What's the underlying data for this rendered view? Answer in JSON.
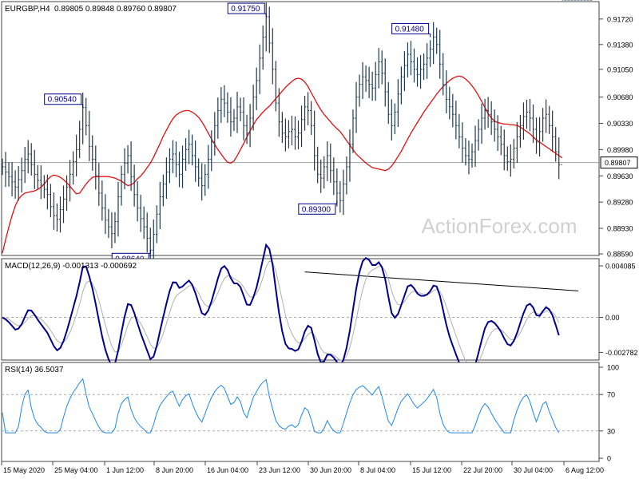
{
  "chart_data": {
    "type": "line",
    "instrument_label": "EURGBP,H4",
    "ohlc_label": "0.89805 0.89848 0.89760 0.89807",
    "x_ticks": [
      "15 May 2020",
      "25 May 04:00",
      "1 Jun 12:00",
      "8 Jun 20:00",
      "16 Jun 04:00",
      "23 Jun 12:00",
      "30 Jun 20:00",
      "8 Jul 04:00",
      "15 Jul 12:00",
      "22 Jul 20:00",
      "30 Jul 04:00",
      "6 Aug 12:00"
    ],
    "price_panel": {
      "ylim": [
        0.8859,
        0.9191
      ],
      "y_ticks": [
        "0.91720",
        "0.91380",
        "0.91050",
        "0.90680",
        "0.90330",
        "0.89980",
        "0.89630",
        "0.89280",
        "0.88930",
        "0.88590"
      ],
      "current_price": "0.89807",
      "x": [
        0,
        2,
        4,
        6,
        8,
        10,
        12,
        14,
        16,
        18,
        20,
        22,
        24,
        26,
        28,
        30,
        32,
        34,
        36,
        38,
        40,
        42,
        44,
        46,
        48,
        50,
        52,
        54,
        56,
        58,
        60,
        62,
        64,
        66,
        68,
        70,
        72,
        74,
        76,
        78,
        80,
        82,
        84,
        86,
        88,
        90,
        92,
        94,
        96,
        98,
        100,
        102,
        104,
        106,
        108,
        110,
        112,
        114,
        116,
        118,
        120,
        122,
        124,
        126,
        128,
        130,
        132,
        134,
        136,
        138,
        140,
        142,
        144,
        146,
        148,
        150,
        152,
        154,
        156,
        158,
        160,
        162,
        164,
        166,
        168,
        170,
        172,
        174,
        176,
        178,
        180,
        182,
        184,
        186,
        188,
        190,
        192,
        194,
        196,
        198,
        200,
        202,
        204,
        206,
        208,
        210,
        212,
        214,
        216,
        218,
        220,
        222,
        224,
        226,
        228,
        230,
        232,
        234,
        236,
        238,
        240,
        242,
        244,
        246,
        248,
        250,
        252,
        254,
        256,
        258,
        260,
        262,
        264,
        266,
        268,
        270,
        272,
        274,
        276,
        278,
        280,
        282,
        284,
        286,
        288,
        290,
        292,
        294,
        296,
        298,
        300,
        302,
        304,
        306,
        308,
        310,
        312,
        314,
        316,
        318,
        320,
        322,
        324,
        326,
        328,
        330,
        332,
        334,
        336,
        338,
        340,
        342,
        344,
        346,
        348,
        350,
        352,
        354,
        356,
        358,
        360,
        362,
        364,
        366
      ],
      "price": [
        0.8975,
        0.8968,
        0.8962,
        0.8955,
        0.8948,
        0.8958,
        0.897,
        0.8985,
        0.8992,
        0.8978,
        0.8965,
        0.8957,
        0.8952,
        0.8945,
        0.8938,
        0.8922,
        0.891,
        0.8905,
        0.8918,
        0.8932,
        0.8948,
        0.8965,
        0.8982,
        0.8998,
        0.9025,
        0.9054,
        0.903,
        0.9002,
        0.8985,
        0.8963,
        0.894,
        0.892,
        0.8904,
        0.8895,
        0.8886,
        0.8902,
        0.8935,
        0.8965,
        0.898,
        0.899,
        0.8962,
        0.8938,
        0.892,
        0.8906,
        0.8895,
        0.888,
        0.8864,
        0.8885,
        0.8912,
        0.8935,
        0.8952,
        0.8968,
        0.8985,
        0.8992,
        0.8978,
        0.8965,
        0.8985,
        0.8998,
        0.9005,
        0.899,
        0.8975,
        0.896,
        0.895,
        0.8965,
        0.8985,
        0.9008,
        0.903,
        0.905,
        0.9065,
        0.906,
        0.9048,
        0.9035,
        0.904,
        0.9055,
        0.9048,
        0.903,
        0.902,
        0.904,
        0.9068,
        0.909,
        0.912,
        0.9148,
        0.9175,
        0.914,
        0.9105,
        0.906,
        0.9035,
        0.902,
        0.9015,
        0.9022,
        0.9025,
        0.9015,
        0.902,
        0.9038,
        0.9055,
        0.905,
        0.903,
        0.899,
        0.8965,
        0.896,
        0.8975,
        0.899,
        0.897,
        0.8955,
        0.894,
        0.893,
        0.8952,
        0.8975,
        0.9005,
        0.904,
        0.9068,
        0.9085,
        0.9095,
        0.909,
        0.9085,
        0.908,
        0.9098,
        0.9115,
        0.91,
        0.9075,
        0.9045,
        0.903,
        0.9048,
        0.9072,
        0.9095,
        0.911,
        0.9125,
        0.9115,
        0.9105,
        0.9098,
        0.9105,
        0.9112,
        0.912,
        0.9132,
        0.9148,
        0.9138,
        0.9112,
        0.9085,
        0.9065,
        0.9055,
        0.9045,
        0.903,
        0.9015,
        0.9,
        0.899,
        0.8985,
        0.8995,
        0.901,
        0.9025,
        0.904,
        0.905,
        0.9045,
        0.9035,
        0.9025,
        0.9015,
        0.9005,
        0.899,
        0.8982,
        0.8985,
        0.9,
        0.9015,
        0.903,
        0.9042,
        0.9048,
        0.904,
        0.9025,
        0.9008,
        0.9022,
        0.904,
        0.9045,
        0.903,
        0.9015,
        0.8995,
        0.8978
      ],
      "ma": [
        0.886,
        0.8878,
        0.8895,
        0.891,
        0.8923,
        0.8932,
        0.8937,
        0.894,
        0.8941,
        0.8942,
        0.8943,
        0.8945,
        0.8948,
        0.8952,
        0.8958,
        0.8962,
        0.8964,
        0.8963,
        0.8961,
        0.8958,
        0.8954,
        0.8949,
        0.8944,
        0.8939,
        0.894,
        0.8946,
        0.8952,
        0.8957,
        0.8961,
        0.8962,
        0.8962,
        0.8962,
        0.8962,
        0.8962,
        0.8961,
        0.896,
        0.8958,
        0.8956,
        0.8953,
        0.895,
        0.8951,
        0.8954,
        0.8959,
        0.8963,
        0.8968,
        0.8974,
        0.898,
        0.8988,
        0.8997,
        0.9006,
        0.9016,
        0.9024,
        0.9032,
        0.9039,
        0.9044,
        0.9047,
        0.9049,
        0.905,
        0.905,
        0.9048,
        0.9045,
        0.9041,
        0.9035,
        0.9028,
        0.902,
        0.9012,
        0.9005,
        0.8998,
        0.8992,
        0.8986,
        0.8981,
        0.898,
        0.8983,
        0.899,
        0.8998,
        0.9006,
        0.9015,
        0.9023,
        0.9031,
        0.9038,
        0.9043,
        0.9048,
        0.9052,
        0.9056,
        0.9061,
        0.9066,
        0.9071,
        0.9076,
        0.9081,
        0.9085,
        0.9089,
        0.9092,
        0.9093,
        0.9092,
        0.9088,
        0.9082,
        0.9074,
        0.9066,
        0.9058,
        0.9051,
        0.9045,
        0.904,
        0.9035,
        0.903,
        0.9026,
        0.9022,
        0.9016,
        0.901,
        0.9004,
        0.8998,
        0.8992,
        0.8988,
        0.8984,
        0.898,
        0.8977,
        0.8974,
        0.8973,
        0.8972,
        0.8971,
        0.897,
        0.8972,
        0.8976,
        0.8982,
        0.8989,
        0.8996,
        0.9004,
        0.9012,
        0.902,
        0.9027,
        0.9034,
        0.9041,
        0.9048,
        0.9054,
        0.906,
        0.9066,
        0.9072,
        0.9077,
        0.9082,
        0.9086,
        0.909,
        0.9093,
        0.9095,
        0.9096,
        0.9095,
        0.9092,
        0.9088,
        0.9083,
        0.9077,
        0.907,
        0.9062,
        0.9054,
        0.9046,
        0.904,
        0.9036,
        0.9034,
        0.9033,
        0.9032,
        0.9032,
        0.9031,
        0.9031,
        0.903,
        0.9028,
        0.9025,
        0.9022,
        0.9019,
        0.9015,
        0.9011,
        0.9008,
        0.9005,
        0.9002,
        0.8999,
        0.8996,
        0.8993,
        0.899,
        0.8987
      ],
      "ma_color": "#e01010",
      "price_color": "#1f3a4d",
      "annotations": [
        {
          "label": "0.90540",
          "price": 0.9054,
          "x": 50
        },
        {
          "label": "0.88640",
          "price": 0.8864,
          "x": 92
        },
        {
          "label": "0.91750",
          "price": 0.9175,
          "x": 164
        },
        {
          "label": "0.89300",
          "price": 0.893,
          "x": 208
        },
        {
          "label": "0.91480",
          "price": 0.9148,
          "x": 266
        }
      ]
    },
    "macd_panel": {
      "label": "MACD(12,26,9) -0.001313 -0.000692",
      "ylim": [
        -0.0032,
        0.0044
      ],
      "y_ticks": [
        "0.004085",
        "0.00",
        "-0.002782"
      ],
      "macd_color": "#00008b",
      "signal_color": "#b0b0b0",
      "trendline": [
        {
          "x": 188,
          "v": 0.0036
        },
        {
          "x": 358,
          "v": 0.0021
        }
      ]
    },
    "rsi_panel": {
      "label": "RSI(14) 36.5037",
      "ylim": [
        0,
        100
      ],
      "y_ticks": [
        "100",
        "70",
        "30",
        "0"
      ],
      "levels": [
        70,
        30
      ],
      "line_color": "#1e88e5"
    },
    "watermark": "ActionForex.com"
  }
}
